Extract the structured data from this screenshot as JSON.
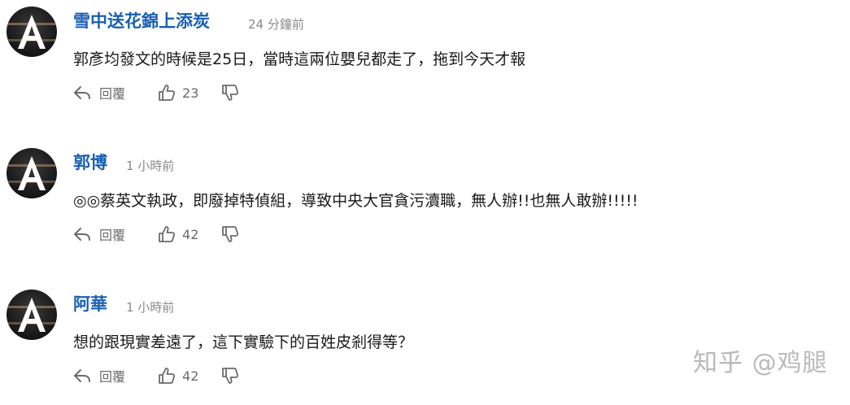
{
  "comments": [
    {
      "author": "雪中送花錦上添炭",
      "time": "24 分鐘前",
      "text": "郭彥均發文的時候是25日，當時這兩位嬰兒都走了，拖到今天才報",
      "reply_label": "回覆",
      "likes": "23"
    },
    {
      "author": "郭博",
      "time": "1 小時前",
      "text": "◎◎蔡英文執政，即廢掉特偵組，導致中央大官貪污瀆職，無人辦!!也無人敢辦!!!!!",
      "reply_label": "回覆",
      "likes": "42"
    },
    {
      "author": "阿華",
      "time": "1 小時前",
      "text": "想的跟現實差遠了，這下實驗下的百姓皮剎得等？",
      "reply_label": "回覆",
      "likes": "42"
    }
  ],
  "watermark": "知乎 @鸡腿",
  "colors": {
    "author": "#1a5fb4",
    "time": "#8a8a8a",
    "text": "#1a1a1a",
    "action": "#6b6b6b"
  },
  "icons": [
    "avatar-letter-a",
    "reply-icon",
    "thumbs-up-icon",
    "thumbs-down-icon"
  ]
}
